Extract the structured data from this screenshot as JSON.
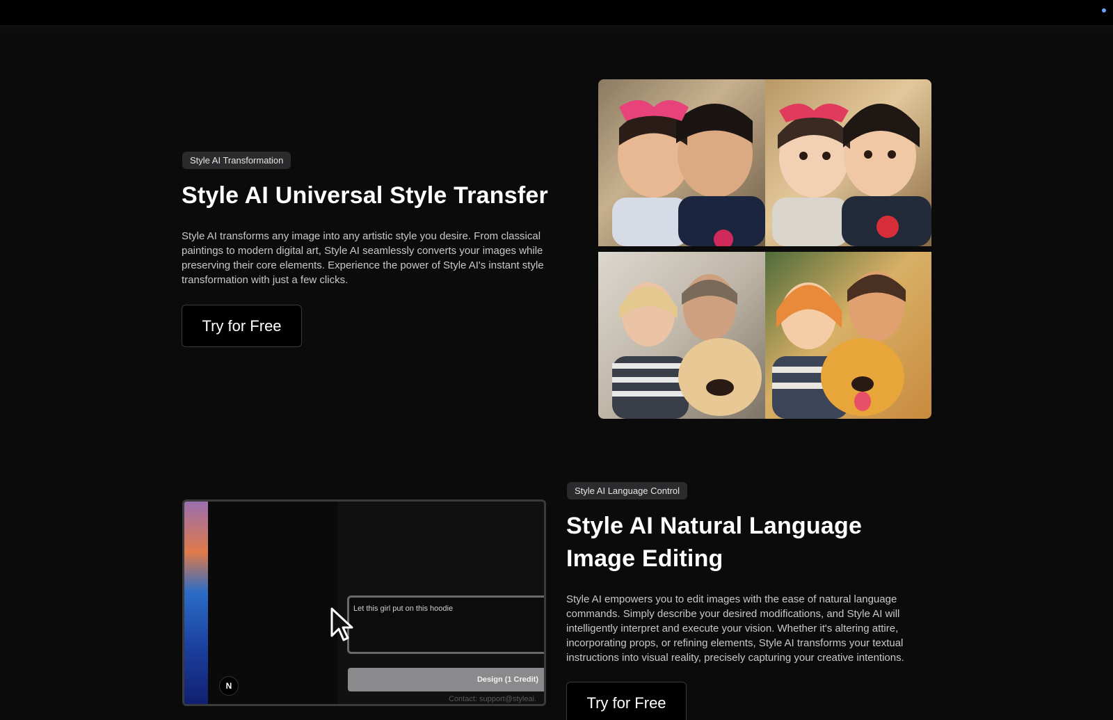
{
  "section1": {
    "badge": "Style AI Transformation",
    "title": "Style AI Universal Style Transfer",
    "description": "Style AI transforms any image into any artistic style you desire. From classical paintings to modern digital art, Style AI seamlessly converts your images while preserving their core elements. Experience the power of Style AI's instant style transformation with just a few clicks.",
    "cta_label": "Try for Free"
  },
  "section2": {
    "badge": "Style AI Language Control",
    "title_line1": "Style AI Natural Language",
    "title_line2": "Image Editing",
    "description": "Style AI empowers you to edit images with the ease of natural language commands. Simply describe your desired modifications, and Style AI will intelligently interpret and execute your vision. Whether it's altering attire, incorporating props, or refining elements, Style AI transforms your textual instructions into visual reality, precisely capturing your creative intentions.",
    "cta_label": "Try for Free"
  },
  "demo": {
    "input_text": "Let this girl put on this hoodie",
    "button_label": "Design (1 Credit)",
    "contact_text": "Contact: support@styleai.",
    "avatar_letter": "N"
  },
  "colors": {
    "background": "#0b0b0c",
    "badge_bg": "#2b2b2e",
    "accent_dot": "#6aa0ff"
  },
  "icons": [
    "mouse-cursor-icon"
  ]
}
